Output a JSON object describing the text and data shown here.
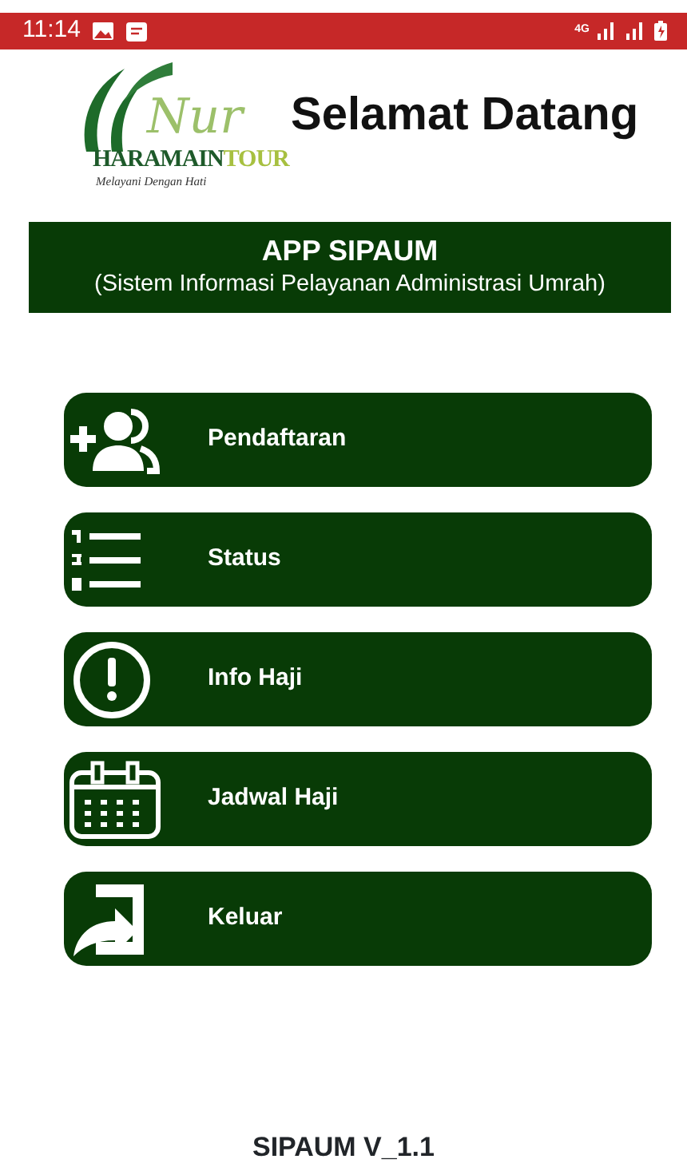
{
  "status_bar": {
    "time": "11:14",
    "network": "4G"
  },
  "header": {
    "logo": {
      "script": "Nur",
      "brand_part1": "HARAMAIN",
      "brand_part2": "TOUR",
      "tagline": "Melayani Dengan Hati"
    },
    "title": "Selamat Datang"
  },
  "banner": {
    "title": "APP SIPAUM",
    "subtitle": "(Sistem Informasi Pelayanan Administrasi Umrah)"
  },
  "menu": [
    {
      "kind": "register",
      "label": "Pendaftaran"
    },
    {
      "kind": "list",
      "label": "Status"
    },
    {
      "kind": "info",
      "label": "Info Haji"
    },
    {
      "kind": "calendar",
      "label": "Jadwal Haji"
    },
    {
      "kind": "exit",
      "label": "Keluar"
    }
  ],
  "footer": "SIPAUM V_1.1"
}
